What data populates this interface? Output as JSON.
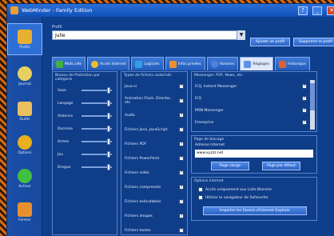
{
  "window": {
    "title": "WebMinder - Family Edition"
  },
  "titlebar": {
    "help": "?",
    "minimize": "_",
    "close": "✕"
  },
  "sidebar": {
    "items": [
      {
        "label": "Profils",
        "icon": "profile-icon",
        "color": "#e8b030"
      },
      {
        "label": "Journal",
        "icon": "people-icon",
        "color": "#e8d060"
      },
      {
        "label": "Outils",
        "icon": "hand-icon",
        "color": "#e8c060"
      },
      {
        "label": "Options",
        "icon": "gear-icon",
        "color": "#e8b020"
      },
      {
        "label": "Activer",
        "icon": "play-icon",
        "color": "#40c040"
      },
      {
        "label": "Fermer",
        "icon": "book-icon",
        "color": "#e89030"
      }
    ]
  },
  "profile": {
    "label": "Profil",
    "selected": "Julie",
    "add_button": "Ajouter un profil",
    "delete_button": "Supprimer le profil"
  },
  "tabs": [
    {
      "label": "Mots clés",
      "icon": "tag-icon",
      "color": "#40b040",
      "active": false
    },
    {
      "label": "Accès Internet",
      "icon": "globe-icon",
      "color": "#e8c030",
      "active": false
    },
    {
      "label": "Logiciels",
      "icon": "app-icon",
      "color": "#30a0e0",
      "active": false
    },
    {
      "label": "Infos privées",
      "icon": "lock-icon",
      "color": "#e89030",
      "active": false
    },
    {
      "label": "Horaires",
      "icon": "clock-icon",
      "color": "#5080e0",
      "active": false
    },
    {
      "label": "Réglages",
      "icon": "settings-icon",
      "color": "#6090e0",
      "active": true
    },
    {
      "label": "Historique",
      "icon": "history-icon",
      "color": "#e06030",
      "active": false
    }
  ],
  "protection": {
    "title": "Niveau de Protection par catégorie",
    "categories": [
      {
        "label": "Sexe",
        "level": 0.85
      },
      {
        "label": "Langage",
        "level": 0.85
      },
      {
        "label": "Violence",
        "level": 0.85
      },
      {
        "label": "Racisme",
        "level": 0.85
      },
      {
        "label": "Armes",
        "level": 0.85
      },
      {
        "label": "Jeu",
        "level": 0.85
      },
      {
        "label": "Drogue",
        "level": 0.85
      }
    ]
  },
  "file_types": {
    "title": "Types de fichiers autorisés",
    "items": [
      {
        "label": "Jeux-vi",
        "checked": true
      },
      {
        "label": "Animation Flash, Director, etc.",
        "checked": true
      },
      {
        "label": "Audio",
        "checked": true
      },
      {
        "label": "Fichiers Java, JavaScript",
        "checked": true
      },
      {
        "label": "Fichiers PDF",
        "checked": true
      },
      {
        "label": "Fichiers PowerPoint",
        "checked": true
      },
      {
        "label": "Fichiers vidéo",
        "checked": true
      },
      {
        "label": "Fichiers compressés",
        "checked": true
      },
      {
        "label": "Fichiers exécutables",
        "checked": true
      },
      {
        "label": "Fichiers images",
        "checked": true
      },
      {
        "label": "Fichiers textes",
        "checked": true
      }
    ]
  },
  "messaging": {
    "title": "Messenger, P2P, News, etc.",
    "items": [
      {
        "label": "ICQ, Instant Messenger",
        "checked": true
      },
      {
        "label": "ICQ",
        "checked": true
      },
      {
        "label": "MSN Messenger",
        "checked": true
      },
      {
        "label": "Emesprise",
        "checked": true
      }
    ]
  },
  "blocking_page": {
    "title": "Page de blocage",
    "address_label": "Adresse Internet",
    "address_value": "www.xyzzz.net",
    "test_button": "Page vierge",
    "default_button": "Page par défaut"
  },
  "internet_options": {
    "title": "Options Internet",
    "items": [
      {
        "label": "Accès uniquement aux Liste Blanche",
        "checked": false
      },
      {
        "label": "Utiliser le navigateur de Safesurfer",
        "checked": false
      }
    ],
    "import_button": "Importer les Favoris d'Internet Explorer"
  }
}
